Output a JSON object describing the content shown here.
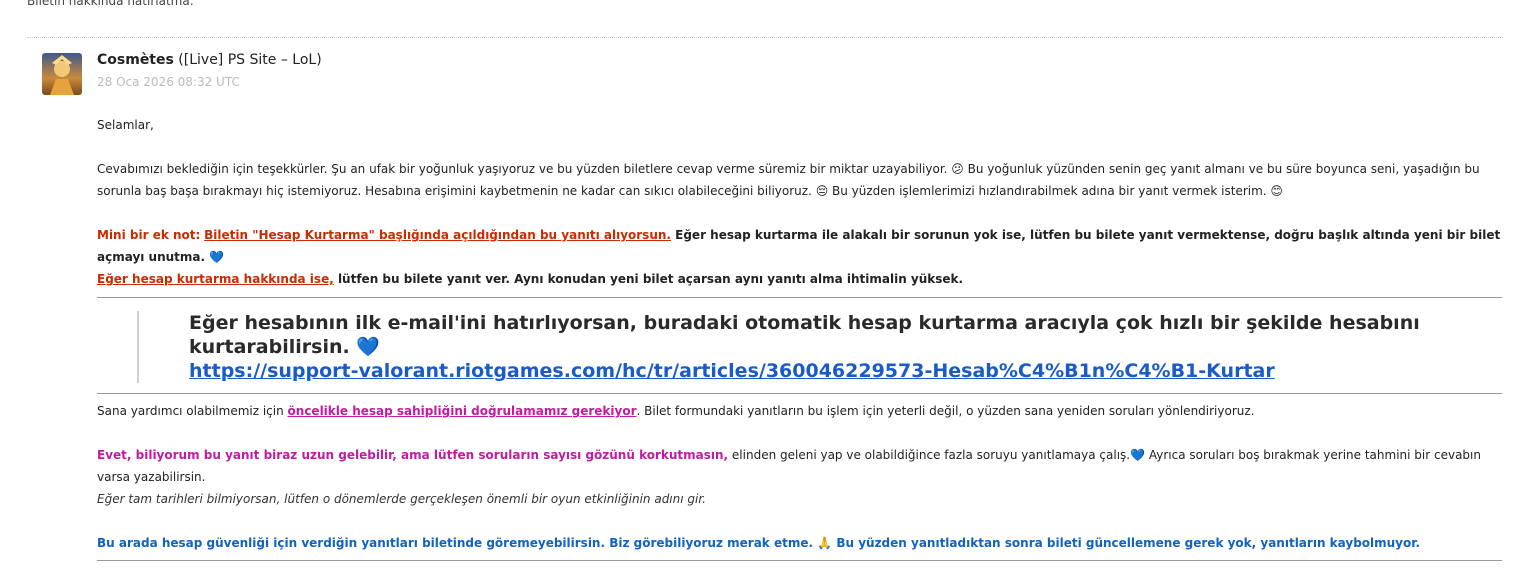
{
  "header_note": "Biletin hakkında hatırlatma:",
  "message": {
    "sender_name": "Cosmètes",
    "sender_group": "([Live] PS Site – LoL)",
    "timestamp": "28 Oca 2026 08:32 UTC",
    "greeting": "Selamlar,",
    "para1": "Cevabımızı beklediğin için teşekkürler. Şu an ufak bir yoğunluk yaşıyoruz ve bu yüzden biletlere cevap verme süremiz bir miktar uzayabiliyor. 😕 Bu yoğunluk yüzünden senin geç yanıt almanı ve bu süre boyunca seni, yaşadığın bu sorunla baş başa bırakmayı hiç istemiyoruz. Hesabına erişimini kaybetmenin ne kadar can sıkıcı olabileceğini biliyoruz. 😔 Bu yüzden işlemlerimizi hızlandırabilmek adına bir yanıt vermek isterim. 😊",
    "note_prefix": "Mini bir ek not:",
    "note_link": "Biletin \"Hesap Kurtarma\" başlığında açıldığından bu yanıtı alıyorsun.",
    "note_rest": " Eğer hesap kurtarma ile alakalı bir sorunun yok ise, lütfen bu bilete yanıt vermektense, doğru başlık altında yeni bir bilet açmayı unutma. 💙",
    "recovery_link": "Eğer hesap kurtarma hakkında ise,",
    "recovery_rest": " lütfen bu bilete yanıt ver. Aynı konudan yeni bilet açarsan aynı yanıtı alma ihtimalin yüksek.",
    "quote_text": "Eğer hesabının ilk e-mail'ini hatırlıyorsan, buradaki otomatik hesap kurtarma aracıyla çok hızlı bir şekilde hesabını kurtarabilirsin. 💙",
    "quote_url": "https://support-valorant.riotgames.com/hc/tr/articles/360046229573-Hesab%C4%B1n%C4%B1-Kurtar",
    "verify_prefix": "Sana yardımcı olabilmemiz için ",
    "verify_link": "öncelikle hesap sahipliğini doğrulamamız gerekiyor",
    "verify_rest": ". Bilet formundaki yanıtların bu işlem için yeterli değil, o yüzden sana yeniden soruları yönlendiriyoruz.",
    "long_bold": "Evet, biliyorum bu yanıt biraz uzun gelebilir, ama lütfen soruların sayısı gözünü korkutmasın,",
    "long_rest": " elinden geleni yap ve olabildiğince fazla soruyu yanıtlamaya çalış.💙 Ayrıca soruları boş bırakmak yerine tahmini bir cevabın varsa yazabilirsin.",
    "italic_hint": "Eğer tam tarihleri bilmiyorsan, lütfen o dönemlerde gerçekleşen önemli bir oyun etkinliğinin adını gir.",
    "security_note": "Bu arada hesap güvenliği için verdiğin yanıtları biletinde göremeyebilirsin. Biz görebiliyoruz merak etme. 🙏 Bu yüzden yanıtladıktan sonra bileti güncellemene gerek yok, yanıtların kaybolmuyor."
  },
  "colors": {
    "red": "#cc2a00",
    "pink": "#c41aa0",
    "blue": "#1262c0",
    "link": "#1a5bc7",
    "timestamp": "#bbbbbb"
  }
}
